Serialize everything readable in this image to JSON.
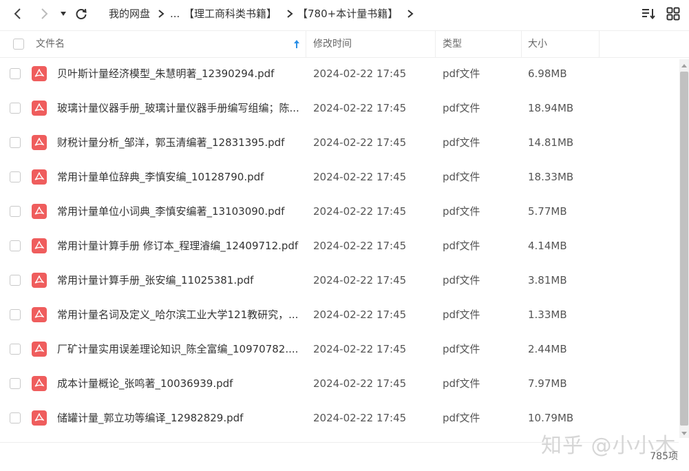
{
  "toolbar": {
    "breadcrumbs": [
      "我的网盘",
      "...",
      "【理工商科类书籍】",
      "【780+本计量书籍】"
    ]
  },
  "header": {
    "name": "文件名",
    "date": "修改时间",
    "type": "类型",
    "size": "大小"
  },
  "files": [
    {
      "name": "贝叶斯计量经济模型_朱慧明著_12390294.pdf",
      "date": "2024-02-22 17:45",
      "type": "pdf文件",
      "size": "6.98MB"
    },
    {
      "name": "玻璃计量仪器手册_玻璃计量仪器手册编写组编；陈...",
      "date": "2024-02-22 17:45",
      "type": "pdf文件",
      "size": "18.94MB"
    },
    {
      "name": "财税计量分析_邹洋，郭玉清编著_12831395.pdf",
      "date": "2024-02-22 17:45",
      "type": "pdf文件",
      "size": "14.81MB"
    },
    {
      "name": "常用计量单位辞典_李慎安编_10128790.pdf",
      "date": "2024-02-22 17:45",
      "type": "pdf文件",
      "size": "18.33MB"
    },
    {
      "name": "常用计量单位小词典_李慎安编著_13103090.pdf",
      "date": "2024-02-22 17:45",
      "type": "pdf文件",
      "size": "5.77MB"
    },
    {
      "name": "常用计量计算手册 修订本_程理濬编_12409712.pdf",
      "date": "2024-02-22 17:45",
      "type": "pdf文件",
      "size": "4.14MB"
    },
    {
      "name": "常用计量计算手册_张安编_11025381.pdf",
      "date": "2024-02-22 17:45",
      "type": "pdf文件",
      "size": "3.81MB"
    },
    {
      "name": "常用计量名词及定义_哈尔滨工业大学121教研究，...",
      "date": "2024-02-22 17:45",
      "type": "pdf文件",
      "size": "1.33MB"
    },
    {
      "name": "厂矿计量实用误差理论知识_陈全富编_10970782....",
      "date": "2024-02-22 17:45",
      "type": "pdf文件",
      "size": "2.44MB"
    },
    {
      "name": "成本计量概论_张鸣著_10036939.pdf",
      "date": "2024-02-22 17:45",
      "type": "pdf文件",
      "size": "7.97MB"
    },
    {
      "name": "储罐计量_郭立功等编译_12982829.pdf",
      "date": "2024-02-22 17:45",
      "type": "pdf文件",
      "size": "10.79MB"
    }
  ],
  "footer": {
    "count": "785项",
    "watermark": "知乎 @小小木"
  },
  "colors": {
    "pdf_icon": "#ef5d5d",
    "sort_arrow": "#2b8fe6"
  },
  "icons": [
    "back-arrow-icon",
    "forward-arrow-icon",
    "dropdown-caret-icon",
    "refresh-icon",
    "chevron-right-icon",
    "sort-list-icon",
    "grid-view-icon",
    "pdf-file-icon",
    "sort-up-arrow-icon"
  ]
}
